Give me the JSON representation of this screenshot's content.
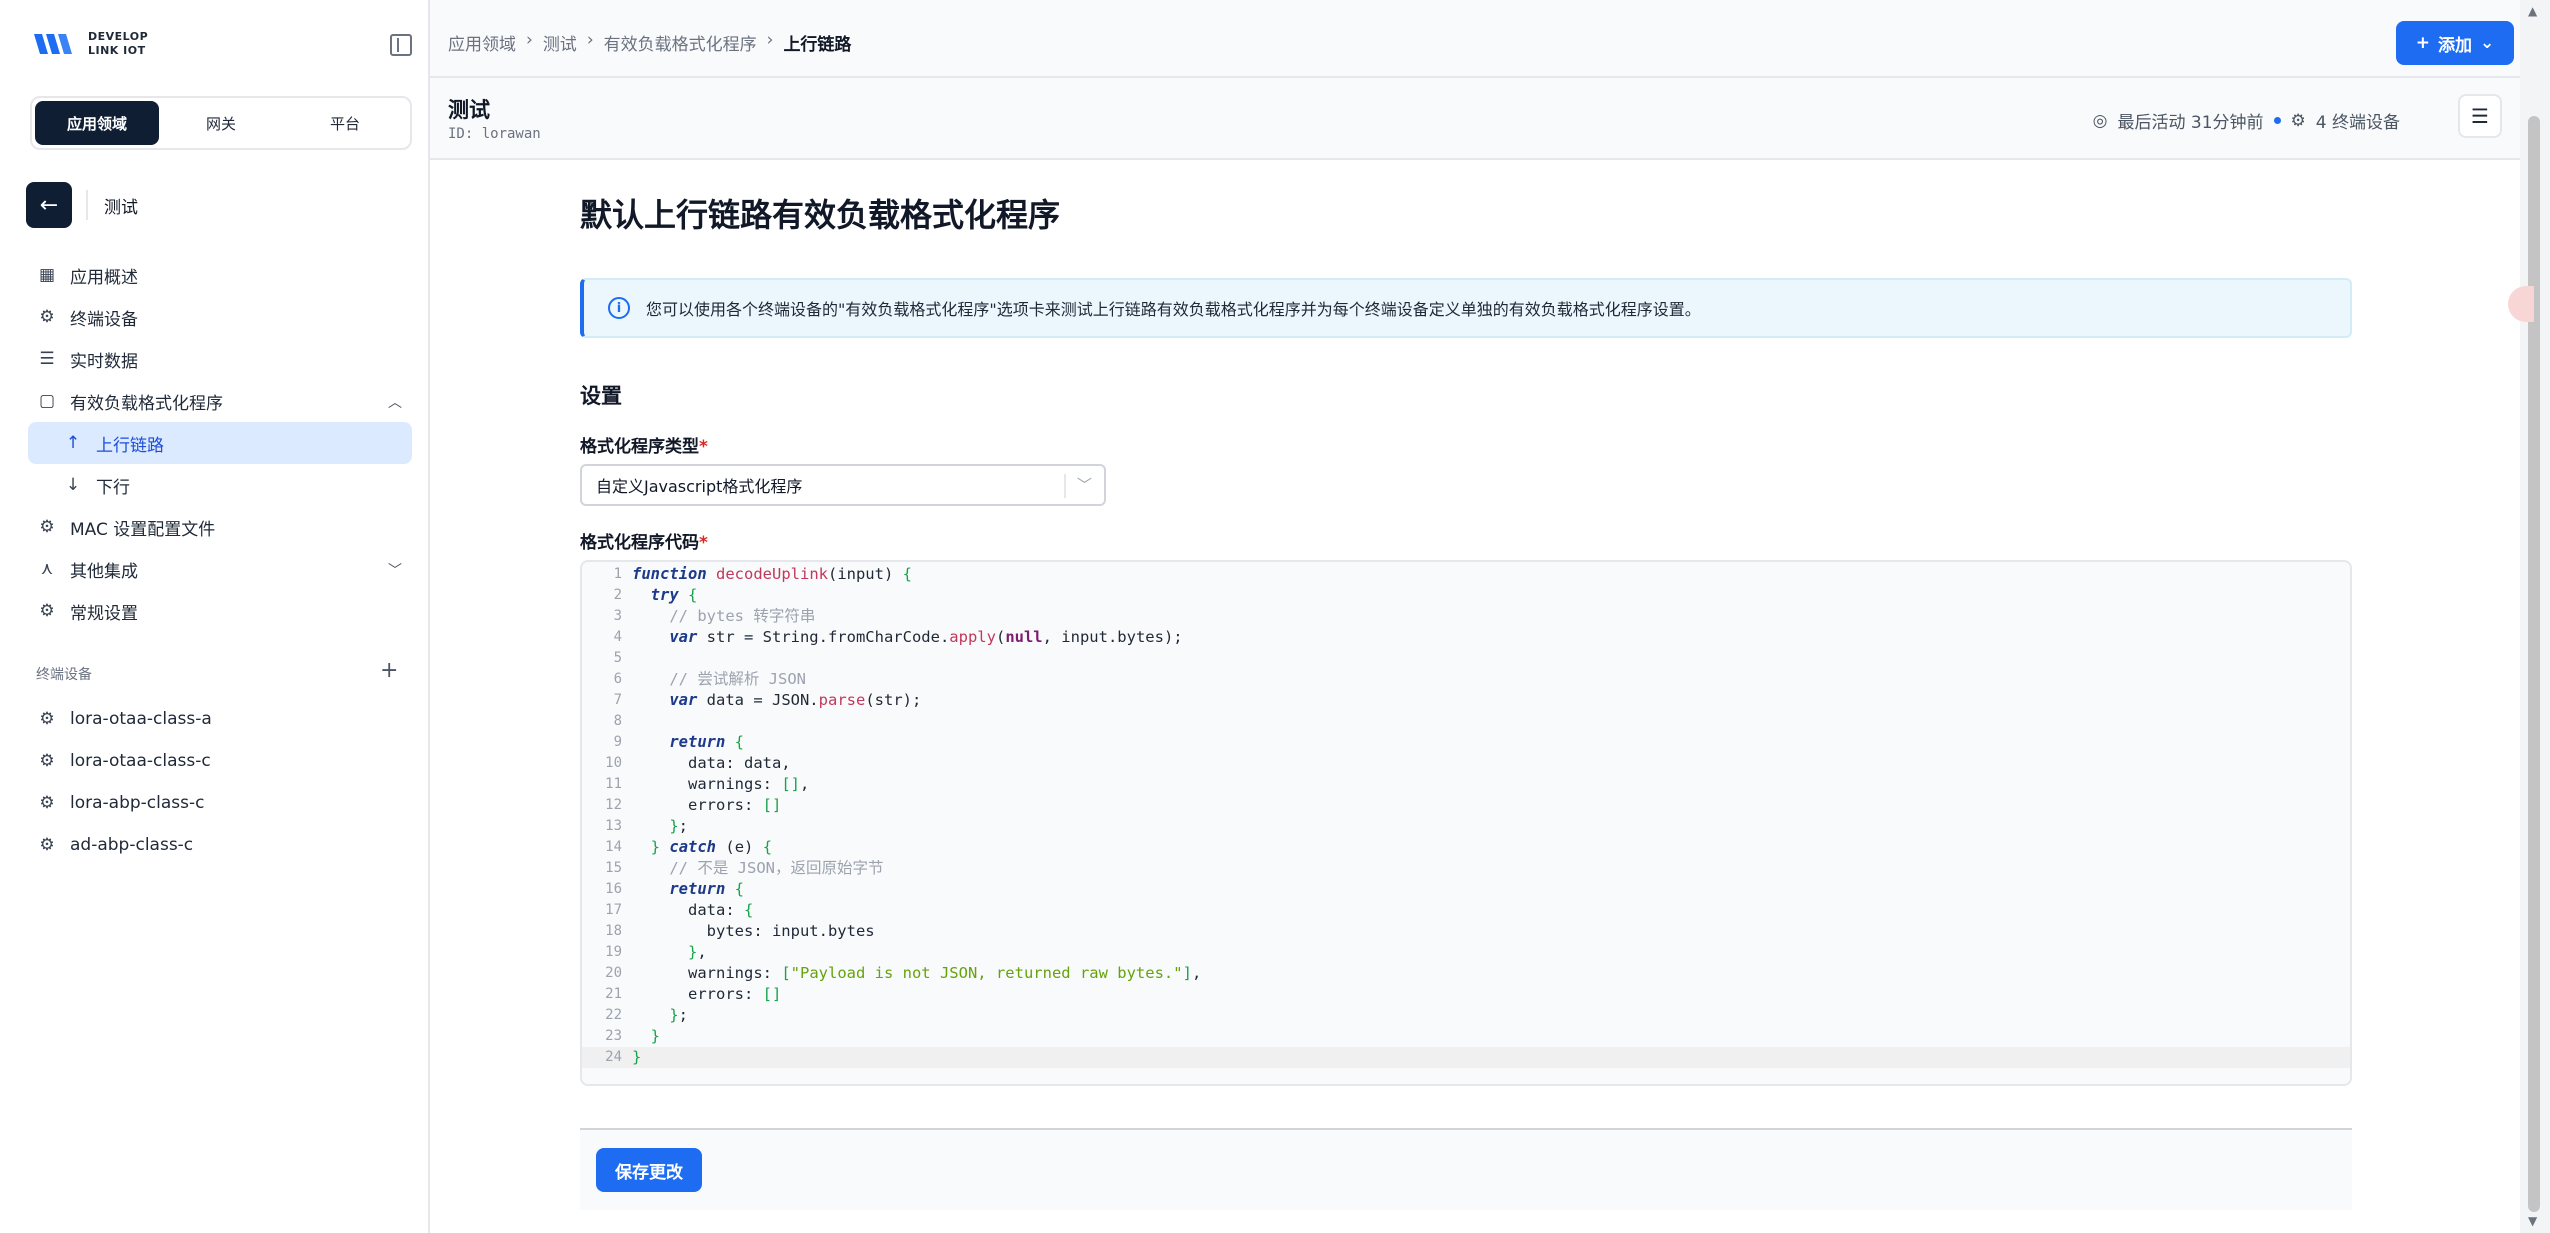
{
  "brand": {
    "line1": "DEVELOP",
    "line2": "LINK IOT"
  },
  "segments": [
    "应用领域",
    "网关",
    "平台"
  ],
  "back_label": "测试",
  "nav": [
    {
      "label": "应用概述",
      "icon": "dashboard-icon"
    },
    {
      "label": "终端设备",
      "icon": "chip-icon"
    },
    {
      "label": "实时数据",
      "icon": "list-icon"
    },
    {
      "label": "有效负载格式化程序",
      "icon": "clipboard-icon"
    },
    {
      "label": "上行链路",
      "icon": "arrow-up-icon"
    },
    {
      "label": "下行",
      "icon": "arrow-down-icon"
    },
    {
      "label": "MAC 设置配置文件",
      "icon": "gear-icon"
    },
    {
      "label": "其他集成",
      "icon": "fork-icon"
    },
    {
      "label": "常规设置",
      "icon": "gear-icon"
    }
  ],
  "devices_section": "终端设备",
  "devices": [
    "lora-otaa-class-a",
    "lora-otaa-class-c",
    "lora-abp-class-c",
    "ad-abp-class-c"
  ],
  "breadcrumb": [
    "应用领域",
    "测试",
    "有效负载格式化程序",
    "上行链路"
  ],
  "add_button": "添加",
  "app": {
    "title": "测试",
    "id": "ID: lorawan",
    "last_activity": "最后活动 31分钟前",
    "devices": "4 终端设备"
  },
  "page_title": "默认上行链路有效负载格式化程序",
  "info_text": "您可以使用各个终端设备的\"有效负载格式化程序\"选项卡来测试上行链路有效负载格式化程序并为每个终端设备定义单独的有效负载格式化程序设置。",
  "settings_title": "设置",
  "formatter_type_label": "格式化程序类型",
  "formatter_type_value": "自定义Javascript格式化程序",
  "formatter_code_label": "格式化程序代码",
  "code_lines": [
    "function decodeUplink(input) {",
    "  try {",
    "    // bytes 转字符串",
    "    var str = String.fromCharCode.apply(null, input.bytes);",
    "",
    "    // 尝试解析 JSON",
    "    var data = JSON.parse(str);",
    "",
    "    return {",
    "      data: data,",
    "      warnings: [],",
    "      errors: []",
    "    };",
    "  } catch (e) {",
    "    // 不是 JSON，返回原始字节",
    "    return {",
    "      data: {",
    "        bytes: input.bytes",
    "      },",
    "      warnings: [\"Payload is not JSON, returned raw bytes.\"],",
    "      errors: []",
    "    };",
    "  }",
    "}"
  ],
  "save_button": "保存更改",
  "colors": {
    "accent": "#1d6cf2",
    "dark": "#0f1e33",
    "active_bg": "#dbeafe"
  }
}
